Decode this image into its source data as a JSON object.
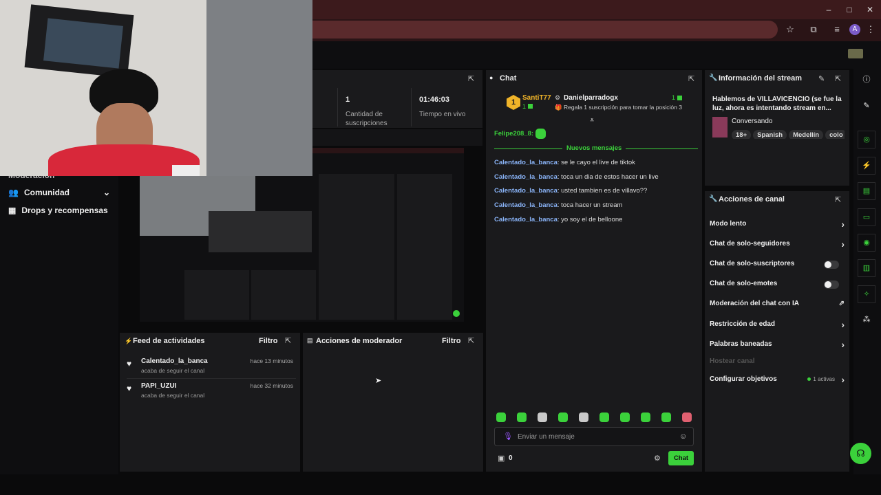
{
  "browser": {
    "window_controls": [
      "–",
      "□",
      "✕"
    ],
    "profile_initial": "A"
  },
  "sidebar": {
    "partial_item": "Moderación",
    "items": [
      {
        "label": "Comunidad",
        "icon": "people-icon"
      },
      {
        "label": "Drops y recompensas",
        "icon": "gift-icon"
      }
    ]
  },
  "stats": {
    "subs_value": "1",
    "subs_label": "Cantidad de suscripciones",
    "live_value": "01:46:03",
    "live_label": "Tiempo en vivo"
  },
  "feed": {
    "title": "Feed de actividades",
    "filter": "Filtro",
    "items": [
      {
        "name": "Calentado_la_banca",
        "sub": "acaba de seguir el canal",
        "time": "hace 13 minutos"
      },
      {
        "name": "PAPI_UZUI",
        "sub": "acaba de seguir el canal",
        "time": "hace 32 minutos"
      }
    ]
  },
  "mod_actions": {
    "title": "Acciones de moderador",
    "filter": "Filtro"
  },
  "chat": {
    "title": "Chat",
    "top_user": "SantiT77",
    "top_count": "1",
    "rank": "1",
    "second_user": "Danielparradogx",
    "second_count": "1",
    "gift_text": "Regala 1 suscripción para tomar la posición 3",
    "pinned_user": "Felipe208_8:",
    "new_messages": "Nuevos mensajes",
    "messages": [
      {
        "user": "Calentado_la_banca",
        "text": ": se le cayo el live de tiktok"
      },
      {
        "user": "Calentado_la_banca",
        "text": ": toca un dia de estos hacer un live"
      },
      {
        "user": "Calentado_la_banca",
        "text": ": usted tambien es de villavo??"
      },
      {
        "user": "Calentado_la_banca",
        "text": ": toca hacer un stream"
      },
      {
        "user": "Calentado_la_banca",
        "text": ": yo soy el de belloone"
      }
    ],
    "input_placeholder": "Enviar un mensaje",
    "points": "0",
    "send_label": "Chat"
  },
  "stream_info": {
    "title": "Información del stream",
    "stream_title": "Hablemos de VILLAVICENCIO (se fue la luz, ahora es intentando stream en...",
    "category": "Conversando",
    "tags": [
      "18+",
      "Spanish",
      "Medellín",
      "colo"
    ]
  },
  "channel_actions": {
    "title": "Acciones de canal",
    "items": [
      {
        "label": "Modo lento",
        "control": "chevron"
      },
      {
        "label": "Chat de solo-seguidores",
        "control": "chevron"
      },
      {
        "label": "Chat de solo-suscriptores",
        "control": "toggle"
      },
      {
        "label": "Chat de solo-emotes",
        "control": "toggle"
      },
      {
        "label": "Moderación del chat con IA",
        "control": "external"
      },
      {
        "label": "Restricción de edad",
        "control": "chevron"
      },
      {
        "label": "Palabras baneadas",
        "control": "chevron"
      },
      {
        "label": "Hostear canal",
        "control": "disabled"
      },
      {
        "label": "Configurar objetivos",
        "control": "chevron"
      }
    ],
    "goals_badge": "1 activas"
  },
  "colors": {
    "accent": "#3bd13b",
    "link": "#8ab4f8",
    "gold": "#f0b429",
    "panel": "#1a1a1c"
  }
}
